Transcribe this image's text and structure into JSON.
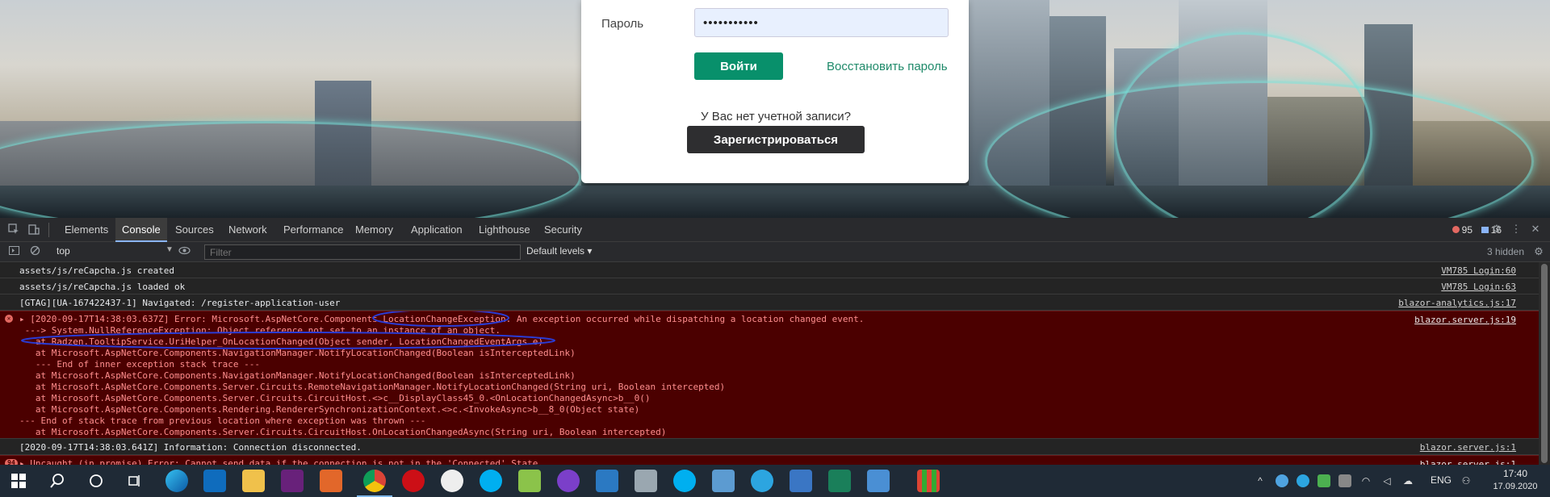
{
  "login": {
    "password_label": "Пароль",
    "password_value": "•••••••••••",
    "login_button": "Войти",
    "restore_link": "Восстановить пароль",
    "no_account_text": "У Вас нет учетной записи?",
    "register_button": "Зарегистрироваться"
  },
  "devtools": {
    "tabs": [
      "Elements",
      "Console",
      "Sources",
      "Network",
      "Performance",
      "Memory",
      "Application",
      "Lighthouse",
      "Security"
    ],
    "active_tab": "Console",
    "error_count": "95",
    "message_count": "16",
    "context": "top",
    "filter_placeholder": "Filter",
    "levels": "Default levels",
    "hidden": "3 hidden"
  },
  "console": {
    "rows": [
      {
        "msg": "assets/js/reCapcha.js created",
        "src": "VM785 Login:60"
      },
      {
        "msg": "assets/js/reCapcha.js loaded ok",
        "src": "VM785 Login:63"
      },
      {
        "msg": "[GTAG][UA-167422437-1] Navigated: /register-application-user",
        "src": "blazor-analytics.js:17"
      }
    ],
    "error_src": "blazor.server.js:19",
    "error_lines": [
      "▸ [2020-09-17T14:38:03.637Z] Error: Microsoft.AspNetCore.Components.LocationChangeException: An exception occurred while dispatching a location changed event.",
      " ---> System.NullReferenceException: Object reference not set to an instance of an object.",
      "   at Radzen.TooltipService.UriHelper_OnLocationChanged(Object sender, LocationChangedEventArgs e)",
      "   at Microsoft.AspNetCore.Components.NavigationManager.NotifyLocationChanged(Boolean isInterceptedLink)",
      "   --- End of inner exception stack trace ---",
      "   at Microsoft.AspNetCore.Components.NavigationManager.NotifyLocationChanged(Boolean isInterceptedLink)",
      "   at Microsoft.AspNetCore.Components.Server.Circuits.RemoteNavigationManager.NotifyLocationChanged(String uri, Boolean intercepted)",
      "   at Microsoft.AspNetCore.Components.Server.Circuits.CircuitHost.<>c__DisplayClass45_0.<OnLocationChangedAsync>b__0()",
      "   at Microsoft.AspNetCore.Components.Rendering.RendererSynchronizationContext.<>c.<InvokeAsync>b__8_0(Object state)",
      "--- End of stack trace from previous location where exception was thrown ---",
      "   at Microsoft.AspNetCore.Components.Server.Circuits.CircuitHost.OnLocationChangedAsync(String uri, Boolean intercepted)"
    ],
    "info_row": {
      "msg": "[2020-09-17T14:38:03.641Z] Information: Connection disconnected.",
      "src": "blazor.server.js:1"
    },
    "last_row": {
      "msg": "▸ Uncaught (in promise) Error: Cannot send data if the connection is not in the 'Connected' State.",
      "src": "blazor.server.js:1"
    }
  },
  "taskbar": {
    "lang": "ENG",
    "time": "17:40",
    "date": "17.09.2020"
  },
  "colors": {
    "accent_green": "#08906b",
    "error_bg": "#4b0000",
    "taskbar_bg": "#1f2a36"
  }
}
